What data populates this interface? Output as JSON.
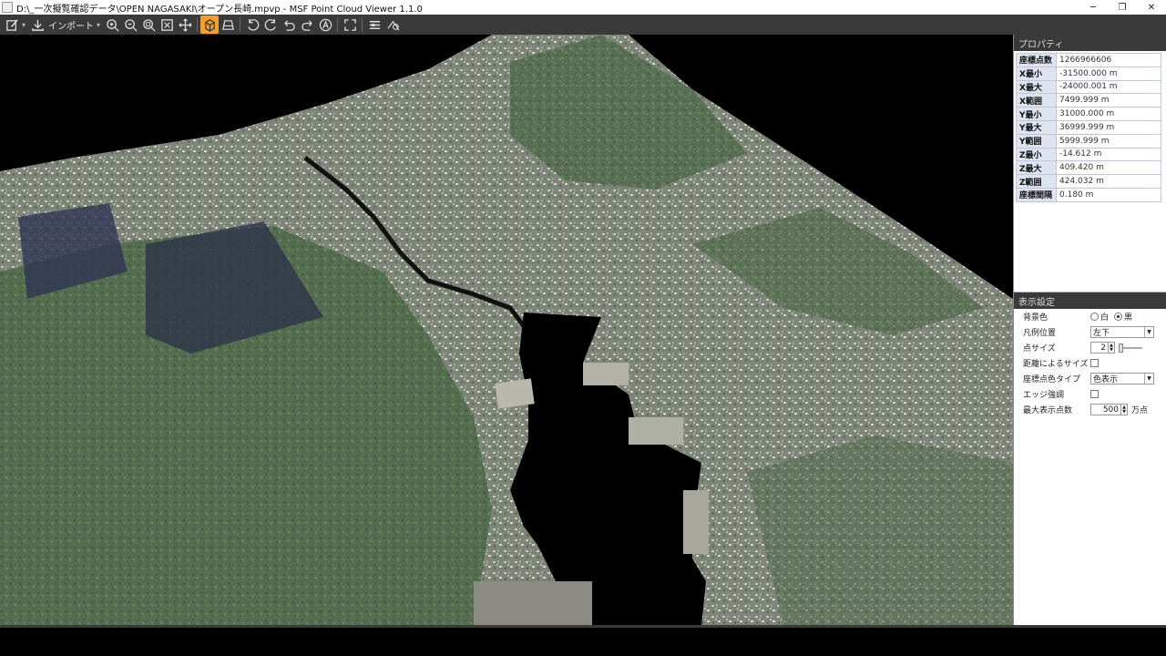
{
  "window": {
    "title": "D:\\_一次擬覧確認データ\\OPEN NAGASAKI\\オープン長崎.mpvp - MSF Point Cloud Viewer 1.1.0",
    "minimize": "─",
    "maximize": "❐",
    "close": "✕"
  },
  "toolbar": {
    "import_label": "インポート",
    "dropdown": "▾"
  },
  "properties": {
    "header": "プロパティ",
    "rows": [
      {
        "key": "座標点数",
        "value": "1266966606"
      },
      {
        "key": "X最小",
        "value": "-31500.000 m"
      },
      {
        "key": "X最大",
        "value": "-24000.001 m"
      },
      {
        "key": "X範囲",
        "value": "7499.999 m"
      },
      {
        "key": "Y最小",
        "value": "31000.000 m"
      },
      {
        "key": "Y最大",
        "value": "36999.999 m"
      },
      {
        "key": "Y範囲",
        "value": "5999.999 m"
      },
      {
        "key": "Z最小",
        "value": "-14.612 m"
      },
      {
        "key": "Z最大",
        "value": "409.420 m"
      },
      {
        "key": "Z範囲",
        "value": "424.032 m"
      },
      {
        "key": "座標間隔",
        "value": "0.180 m"
      }
    ]
  },
  "display_settings": {
    "header": "表示設定",
    "background_color": {
      "label": "背景色",
      "options": [
        "白",
        "黒"
      ],
      "selected": "黒"
    },
    "legend_position": {
      "label": "凡例位置",
      "value": "左下"
    },
    "point_size": {
      "label": "点サイズ",
      "value": "2"
    },
    "size_by_distance": {
      "label": "距離によるサイズ",
      "checked": false
    },
    "point_color_type": {
      "label": "座標点色タイプ",
      "value": "色表示"
    },
    "edge_enhance": {
      "label": "エッジ強調",
      "checked": false
    },
    "max_points": {
      "label": "最大表示点数",
      "value": "500",
      "unit": "万点"
    }
  }
}
